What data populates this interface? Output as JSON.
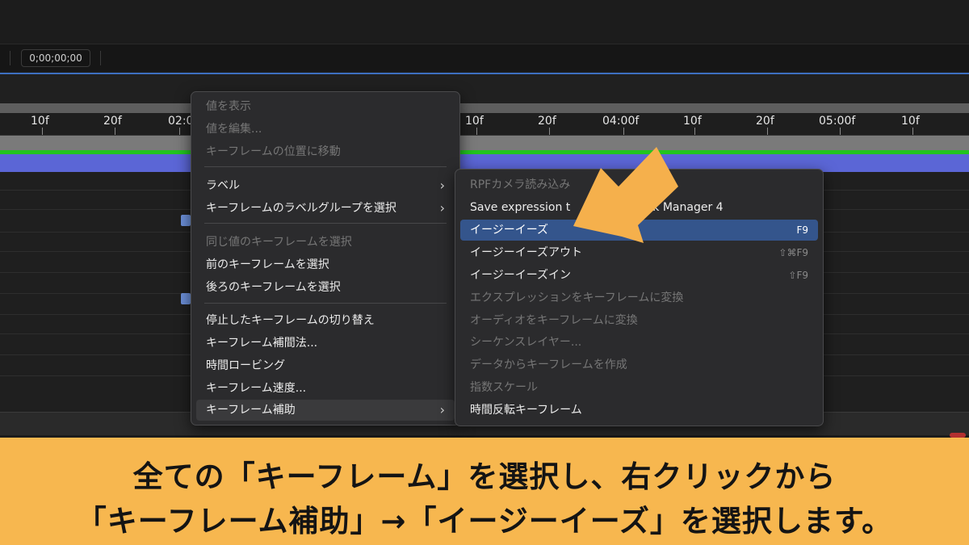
{
  "timecode": "0;00;00;00",
  "ruler": {
    "labels": [
      "10f",
      "20f",
      "02:0",
      "10f",
      "20f",
      "04:00f",
      "10f",
      "20f",
      "05:00f",
      "10f"
    ]
  },
  "context_menu": {
    "items": [
      {
        "label": "値を表示",
        "disabled": true
      },
      {
        "label": "値を編集...",
        "disabled": true
      },
      {
        "label": "キーフレームの位置に移動",
        "disabled": true
      },
      {
        "label": "ラベル",
        "submenu": true
      },
      {
        "label": "キーフレームのラベルグループを選択",
        "submenu": true
      },
      {
        "label": "同じ値のキーフレームを選択",
        "disabled": true
      },
      {
        "label": "前のキーフレームを選択"
      },
      {
        "label": "後ろのキーフレームを選択"
      },
      {
        "label": "停止したキーフレームの切り替え"
      },
      {
        "label": "キーフレーム補間法..."
      },
      {
        "label": "時間ロービング"
      },
      {
        "label": "キーフレーム速度..."
      },
      {
        "label": "キーフレーム補助",
        "submenu": true,
        "highlighted": true
      }
    ]
  },
  "submenu": {
    "items": [
      {
        "label": "RPFカメラ読み込み",
        "disabled": true
      },
      {
        "label": "Save expression t",
        "suffix": "ack Manager 4"
      },
      {
        "label": "イージーイーズ",
        "shortcut": "F9",
        "highlighted": true
      },
      {
        "label": "イージーイーズアウト",
        "shortcut": "⇧⌘F9"
      },
      {
        "label": "イージーイーズイン",
        "shortcut": "⇧F9"
      },
      {
        "label": "エクスプレッションをキーフレームに変換",
        "disabled": true
      },
      {
        "label": "オーディオをキーフレームに変換",
        "disabled": true
      },
      {
        "label": "シーケンスレイヤー...",
        "disabled": true
      },
      {
        "label": "データからキーフレームを作成",
        "disabled": true
      },
      {
        "label": "指数スケール",
        "disabled": true
      },
      {
        "label": "時間反転キーフレーム"
      }
    ]
  },
  "caption": {
    "line1": "全ての「キーフレーム」を選択し、右クリックから",
    "line2": "「キーフレーム補助」→「イージーイーズ」を選択します。"
  },
  "colors": {
    "caption_bg": "#f7b74f",
    "arrow": "#f5b04c",
    "highlight": "#34558c",
    "green_bar": "#22c41f",
    "purple_bar": "#5b66d6"
  }
}
